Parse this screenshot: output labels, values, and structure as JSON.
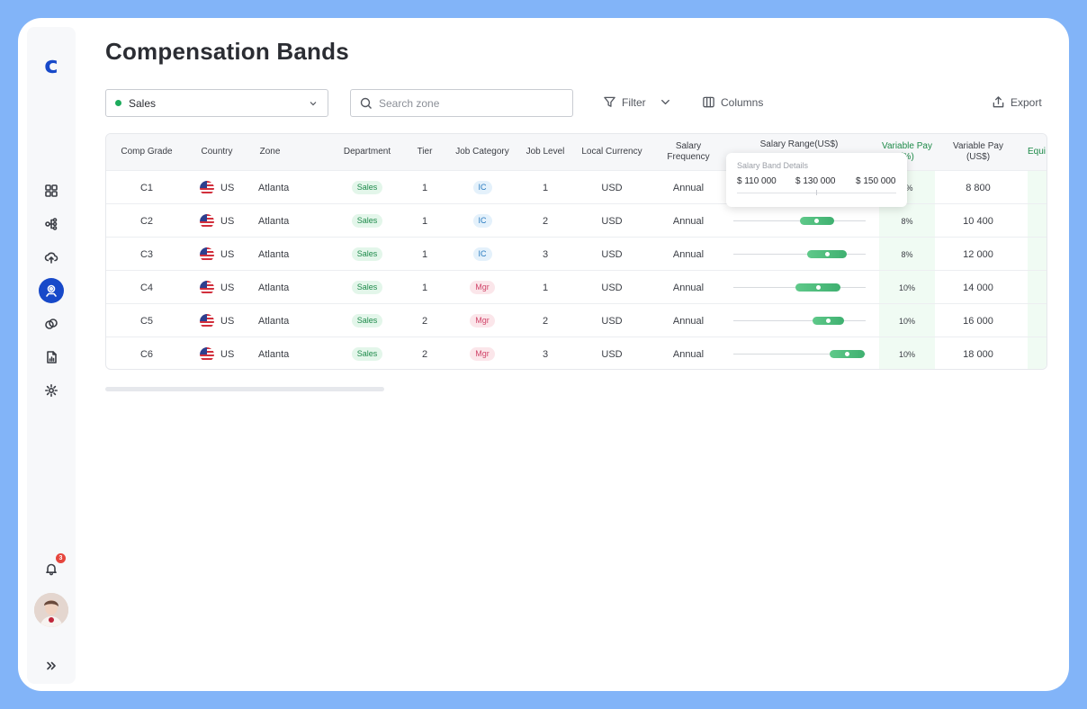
{
  "app": {
    "logo": "c"
  },
  "page": {
    "title": "Compensation Bands"
  },
  "toolbar": {
    "department_select": "Sales",
    "search_placeholder": "Search zone",
    "filter_label": "Filter",
    "columns_label": "Columns",
    "export_label": "Export"
  },
  "table": {
    "headers": {
      "comp_grade": "Comp Grade",
      "country": "Country",
      "zone": "Zone",
      "department": "Department",
      "tier": "Tier",
      "job_category": "Job Category",
      "job_level": "Job Level",
      "local_currency": "Local Currency",
      "salary_frequency": "Salary Frequency",
      "salary_range": "Salary Range(US$)",
      "variable_pay_pct": "Variable Pay (%)",
      "variable_pay_usd": "Variable Pay (US$)",
      "equity": "Equi"
    },
    "rows": [
      {
        "grade": "C1",
        "country": "US",
        "zone": "Atlanta",
        "department": "Sales",
        "tier": "1",
        "category": "IC",
        "level": "1",
        "currency": "USD",
        "frequency": "Annual",
        "range_fraction": [
          0.48,
          0.63,
          0.56
        ],
        "var_pct": "8%",
        "var_usd": "8 800"
      },
      {
        "grade": "C2",
        "country": "US",
        "zone": "Atlanta",
        "department": "Sales",
        "tier": "1",
        "category": "IC",
        "level": "2",
        "currency": "USD",
        "frequency": "Annual",
        "range_fraction": [
          0.5,
          0.76,
          0.63
        ],
        "var_pct": "8%",
        "var_usd": "10 400"
      },
      {
        "grade": "C3",
        "country": "US",
        "zone": "Atlanta",
        "department": "Sales",
        "tier": "1",
        "category": "IC",
        "level": "3",
        "currency": "USD",
        "frequency": "Annual",
        "range_fraction": [
          0.56,
          0.86,
          0.71
        ],
        "var_pct": "8%",
        "var_usd": "12 000"
      },
      {
        "grade": "C4",
        "country": "US",
        "zone": "Atlanta",
        "department": "Sales",
        "tier": "1",
        "category": "Mgr",
        "level": "1",
        "currency": "USD",
        "frequency": "Annual",
        "range_fraction": [
          0.47,
          0.81,
          0.64
        ],
        "var_pct": "10%",
        "var_usd": "14 000"
      },
      {
        "grade": "C5",
        "country": "US",
        "zone": "Atlanta",
        "department": "Sales",
        "tier": "2",
        "category": "Mgr",
        "level": "2",
        "currency": "USD",
        "frequency": "Annual",
        "range_fraction": [
          0.6,
          0.84,
          0.72
        ],
        "var_pct": "10%",
        "var_usd": "16 000"
      },
      {
        "grade": "C6",
        "country": "US",
        "zone": "Atlanta",
        "department": "Sales",
        "tier": "2",
        "category": "Mgr",
        "level": "3",
        "currency": "USD",
        "frequency": "Annual",
        "range_fraction": [
          0.73,
          0.99,
          0.86
        ],
        "var_pct": "10%",
        "var_usd": "18 000"
      }
    ]
  },
  "tooltip": {
    "title": "Salary Band Details",
    "min": "$ 110 000",
    "mid": "$ 130 000",
    "max": "$ 150 000"
  },
  "notifications": {
    "count": "3"
  },
  "colors": {
    "brand": "#1749c9",
    "accent_green": "#3fb070",
    "frame": "#82b4f8"
  }
}
